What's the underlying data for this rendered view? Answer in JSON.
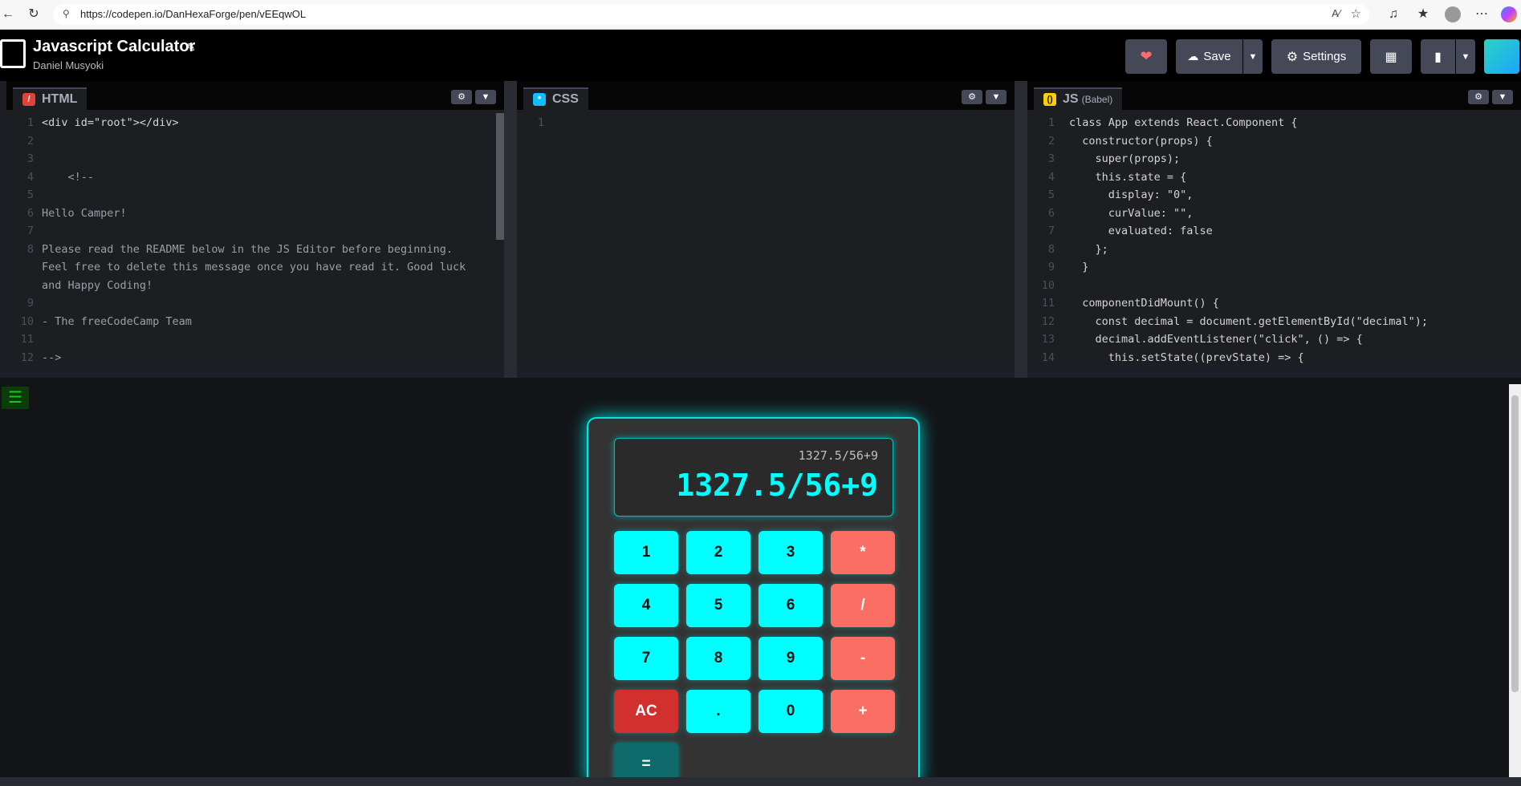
{
  "browser": {
    "url": "https://codepen.io/DanHexaForge/pen/vEEqwOL",
    "back_icon": "back-arrow-icon",
    "reload_icon": "reload-icon"
  },
  "header": {
    "title": "Javascript Calculator",
    "author": "Daniel Musyoki",
    "save_label": "Save",
    "settings_label": "Settings"
  },
  "editors": {
    "html": {
      "label": "HTML",
      "lines": [
        {
          "n": "1",
          "text": "<div id=\"root\"></div>"
        },
        {
          "n": "2",
          "text": ""
        },
        {
          "n": "3",
          "text": ""
        },
        {
          "n": "4",
          "text": "    <!--"
        },
        {
          "n": "5",
          "text": ""
        },
        {
          "n": "6",
          "text": "Hello Camper!"
        },
        {
          "n": "7",
          "text": ""
        },
        {
          "n": "8",
          "text": "Please read the README below in the JS Editor before beginning."
        },
        {
          "n": "",
          "text": "Feel free to delete this message once you have read it. Good luck"
        },
        {
          "n": "",
          "text": "and Happy Coding!"
        },
        {
          "n": "9",
          "text": ""
        },
        {
          "n": "10",
          "text": "- The freeCodeCamp Team"
        },
        {
          "n": "11",
          "text": ""
        },
        {
          "n": "12",
          "text": "-->"
        }
      ]
    },
    "css": {
      "label": "CSS",
      "lines": [
        {
          "n": "1",
          "text": ""
        }
      ]
    },
    "js": {
      "label": "JS",
      "sublabel": "(Babel)",
      "lines": [
        {
          "n": "1",
          "text": "class App extends React.Component {"
        },
        {
          "n": "2",
          "text": "  constructor(props) {"
        },
        {
          "n": "3",
          "text": "    super(props);"
        },
        {
          "n": "4",
          "text": "    this.state = {"
        },
        {
          "n": "5",
          "text": "      display: \"0\","
        },
        {
          "n": "6",
          "text": "      curValue: \"\","
        },
        {
          "n": "7",
          "text": "      evaluated: false"
        },
        {
          "n": "8",
          "text": "    };"
        },
        {
          "n": "9",
          "text": "  }"
        },
        {
          "n": "10",
          "text": ""
        },
        {
          "n": "11",
          "text": "  componentDidMount() {"
        },
        {
          "n": "12",
          "text": "    const decimal = document.getElementById(\"decimal\");"
        },
        {
          "n": "13",
          "text": "    decimal.addEventListener(\"click\", () => {"
        },
        {
          "n": "14",
          "text": "      this.setState((prevState) => {"
        }
      ]
    }
  },
  "calculator": {
    "formula": "1327.5/56+9",
    "display": "1327.5/56+9",
    "keys": [
      "1",
      "2",
      "3",
      "*",
      "4",
      "5",
      "6",
      "/",
      "7",
      "8",
      "9",
      "-",
      "AC",
      ".",
      "0",
      "+",
      "="
    ]
  },
  "colors": {
    "number_key": "#00ffff",
    "operator_key": "#fa6e64",
    "clear_key": "#d22f2f",
    "equals_key": "#0f6b6b"
  }
}
